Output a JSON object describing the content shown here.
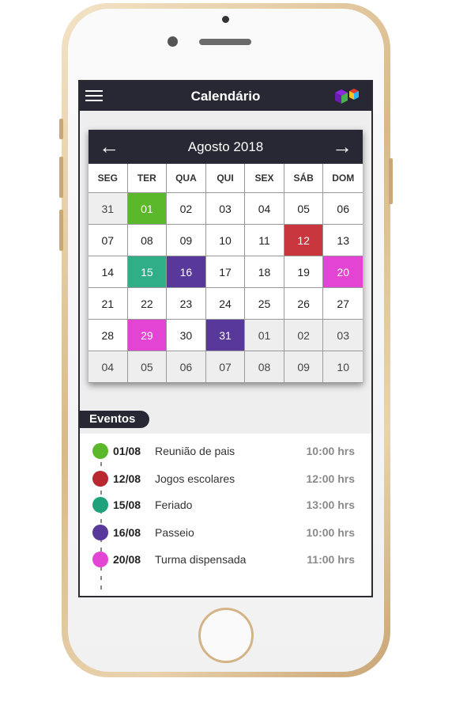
{
  "app": {
    "title": "Calendário"
  },
  "calendar": {
    "month_title": "Agosto 2018",
    "prev_icon": "arrow-left-icon",
    "next_icon": "arrow-right-icon",
    "weekdays": [
      "SEG",
      "TER",
      "QUA",
      "QUI",
      "SEX",
      "SÁB",
      "DOM"
    ],
    "days": [
      {
        "label": "31",
        "other": true
      },
      {
        "label": "01",
        "event_color": "#5cb82b"
      },
      {
        "label": "02"
      },
      {
        "label": "03"
      },
      {
        "label": "04"
      },
      {
        "label": "05"
      },
      {
        "label": "06"
      },
      {
        "label": "07"
      },
      {
        "label": "08"
      },
      {
        "label": "09"
      },
      {
        "label": "10"
      },
      {
        "label": "11"
      },
      {
        "label": "12",
        "event_color": "#c9363d"
      },
      {
        "label": "13"
      },
      {
        "label": "14"
      },
      {
        "label": "15",
        "event_color": "#2fae88"
      },
      {
        "label": "16",
        "event_color": "#58389b"
      },
      {
        "label": "17"
      },
      {
        "label": "18"
      },
      {
        "label": "19"
      },
      {
        "label": "20",
        "event_color": "#e444d4"
      },
      {
        "label": "21"
      },
      {
        "label": "22"
      },
      {
        "label": "23"
      },
      {
        "label": "24"
      },
      {
        "label": "25"
      },
      {
        "label": "26"
      },
      {
        "label": "27"
      },
      {
        "label": "28"
      },
      {
        "label": "29",
        "event_color": "#e444d4"
      },
      {
        "label": "30"
      },
      {
        "label": "31",
        "event_color": "#58389b"
      },
      {
        "label": "01",
        "other": true
      },
      {
        "label": "02",
        "other": true
      },
      {
        "label": "03",
        "other": true
      },
      {
        "label": "04",
        "other": true
      },
      {
        "label": "05",
        "other": true
      },
      {
        "label": "06",
        "other": true
      },
      {
        "label": "07",
        "other": true
      },
      {
        "label": "08",
        "other": true
      },
      {
        "label": "09",
        "other": true
      },
      {
        "label": "10",
        "other": true
      }
    ]
  },
  "events": {
    "heading": "Eventos",
    "items": [
      {
        "date": "01/08",
        "title": "Reunião de pais",
        "time": "10:00 hrs",
        "color": "#5cb82b"
      },
      {
        "date": "12/08",
        "title": "Jogos escolares",
        "time": "12:00 hrs",
        "color": "#b8282e"
      },
      {
        "date": "15/08",
        "title": "Feriado",
        "time": "13:00 hrs",
        "color": "#1fa27b"
      },
      {
        "date": "16/08",
        "title": "Passeio",
        "time": "10:00 hrs",
        "color": "#58389b"
      },
      {
        "date": "20/08",
        "title": "Turma dispensada",
        "time": "11:00 hrs",
        "color": "#e444d4"
      }
    ]
  },
  "colors": {
    "app_bar": "#272833",
    "screen_bg": "#eeeeee",
    "phone_gold": "#d9b98a"
  }
}
